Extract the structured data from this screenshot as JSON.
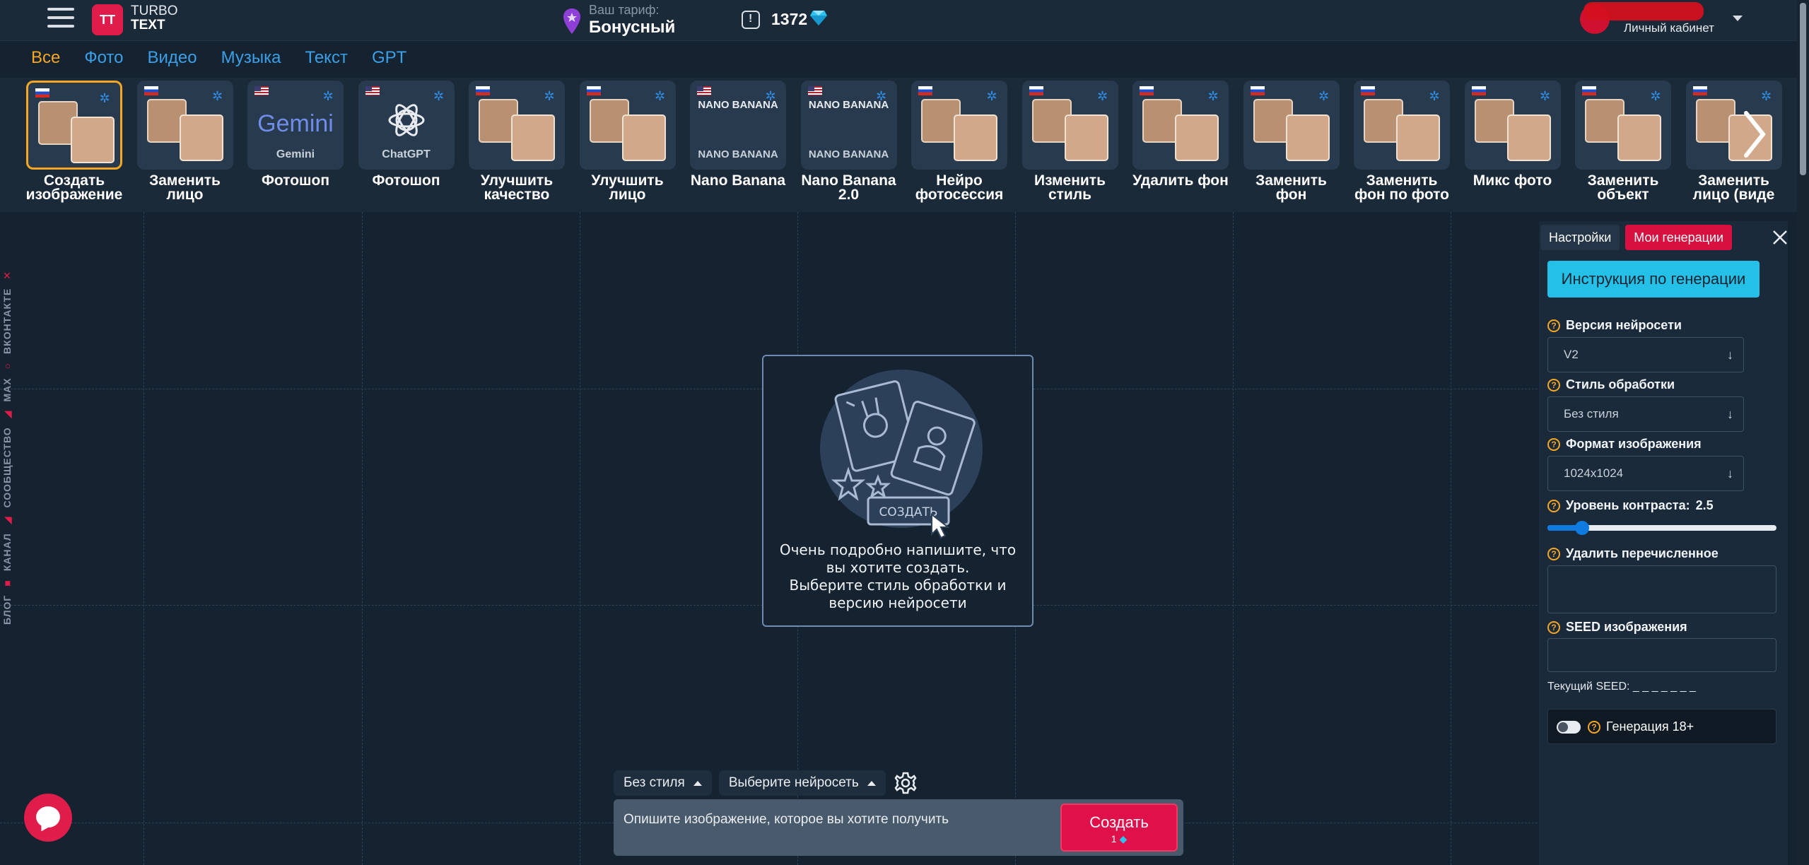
{
  "header": {
    "logo_mark": "TT",
    "logo_line1": "TURBO",
    "logo_line2": "TEXT",
    "tariff_label": "Ваш тариф:",
    "tariff_name": "Бонусный",
    "balance": "1372",
    "cabinet_label": "Личный кабинет"
  },
  "categories": [
    "Все",
    "Фото",
    "Видео",
    "Музыка",
    "Текст",
    "GPT"
  ],
  "active_category": "Все",
  "tools": [
    {
      "label": "Создать изображение",
      "flag": "ru",
      "active": true
    },
    {
      "label": "Заменить лицо",
      "flag": "ru"
    },
    {
      "label": "Фотошоп",
      "flag": "us",
      "thumb_text": "Gemini",
      "thumb_sub": "Gemini"
    },
    {
      "label": "Фотошоп",
      "flag": "us",
      "thumb_sub": "ChatGPT"
    },
    {
      "label": "Улучшить качество",
      "flag": "ru"
    },
    {
      "label": "Улучшить лицо",
      "flag": "ru"
    },
    {
      "label": "Nano Banana",
      "flag": "us",
      "thumb_text": "NANO BANANA",
      "thumb_sub": "NANO BANANA"
    },
    {
      "label": "Nano Banana 2.0",
      "flag": "us",
      "thumb_text": "NANO BANANA",
      "thumb_sub": "NANO BANANA"
    },
    {
      "label": "Нейро фотосессия",
      "flag": "ru"
    },
    {
      "label": "Изменить стиль",
      "flag": "ru"
    },
    {
      "label": "Удалить фон",
      "flag": "ru"
    },
    {
      "label": "Заменить фон",
      "flag": "ru"
    },
    {
      "label": "Заменить фон по фото",
      "flag": "ru"
    },
    {
      "label": "Микс фото",
      "flag": "ru"
    },
    {
      "label": "Заменить объект",
      "flag": "ru"
    },
    {
      "label": "Заменить лицо (виде",
      "flag": "ru"
    }
  ],
  "side_links": [
    "БЛОГ",
    "КАНАЛ",
    "СООБЩЕСТВО",
    "MAX",
    "ВКОНТАКТЕ"
  ],
  "placeholder": {
    "button_text": "СОЗДАТЬ",
    "line1": "Очень подробно напишите, что",
    "line2": "вы хотите создать.",
    "line3": "Выберите стиль обработки и",
    "line4": "версию нейросети"
  },
  "prompt": {
    "style_label": "Без стиля",
    "model_label": "Выберите нейросеть",
    "placeholder": "Опишите изображение, которое вы хотите получить",
    "create_label": "Создать",
    "create_cost": "1"
  },
  "panel": {
    "tab_settings": "Настройки",
    "tab_mine": "Мои генерации",
    "instruction_button": "Инструкция по генерации",
    "version_label": "Версия нейросети",
    "version_value": "V2",
    "style_label": "Стиль обработки",
    "style_value": "Без стиля",
    "format_label": "Формат изображения",
    "format_value": "1024x1024",
    "contrast_label": "Уровень контраста:",
    "contrast_value": "2.5",
    "contrast_fraction": 0.15,
    "remove_label": "Удалить перечисленное",
    "seed_label": "SEED изображения",
    "seed_current": "Текущий SEED: _ _ _ _ _ _ _",
    "nsfw_label": "Генерация 18+"
  },
  "colors": {
    "accent": "#f5a623",
    "link": "#3aa0e8",
    "brand": "#e01c4b",
    "instr": "#25c0e8"
  }
}
